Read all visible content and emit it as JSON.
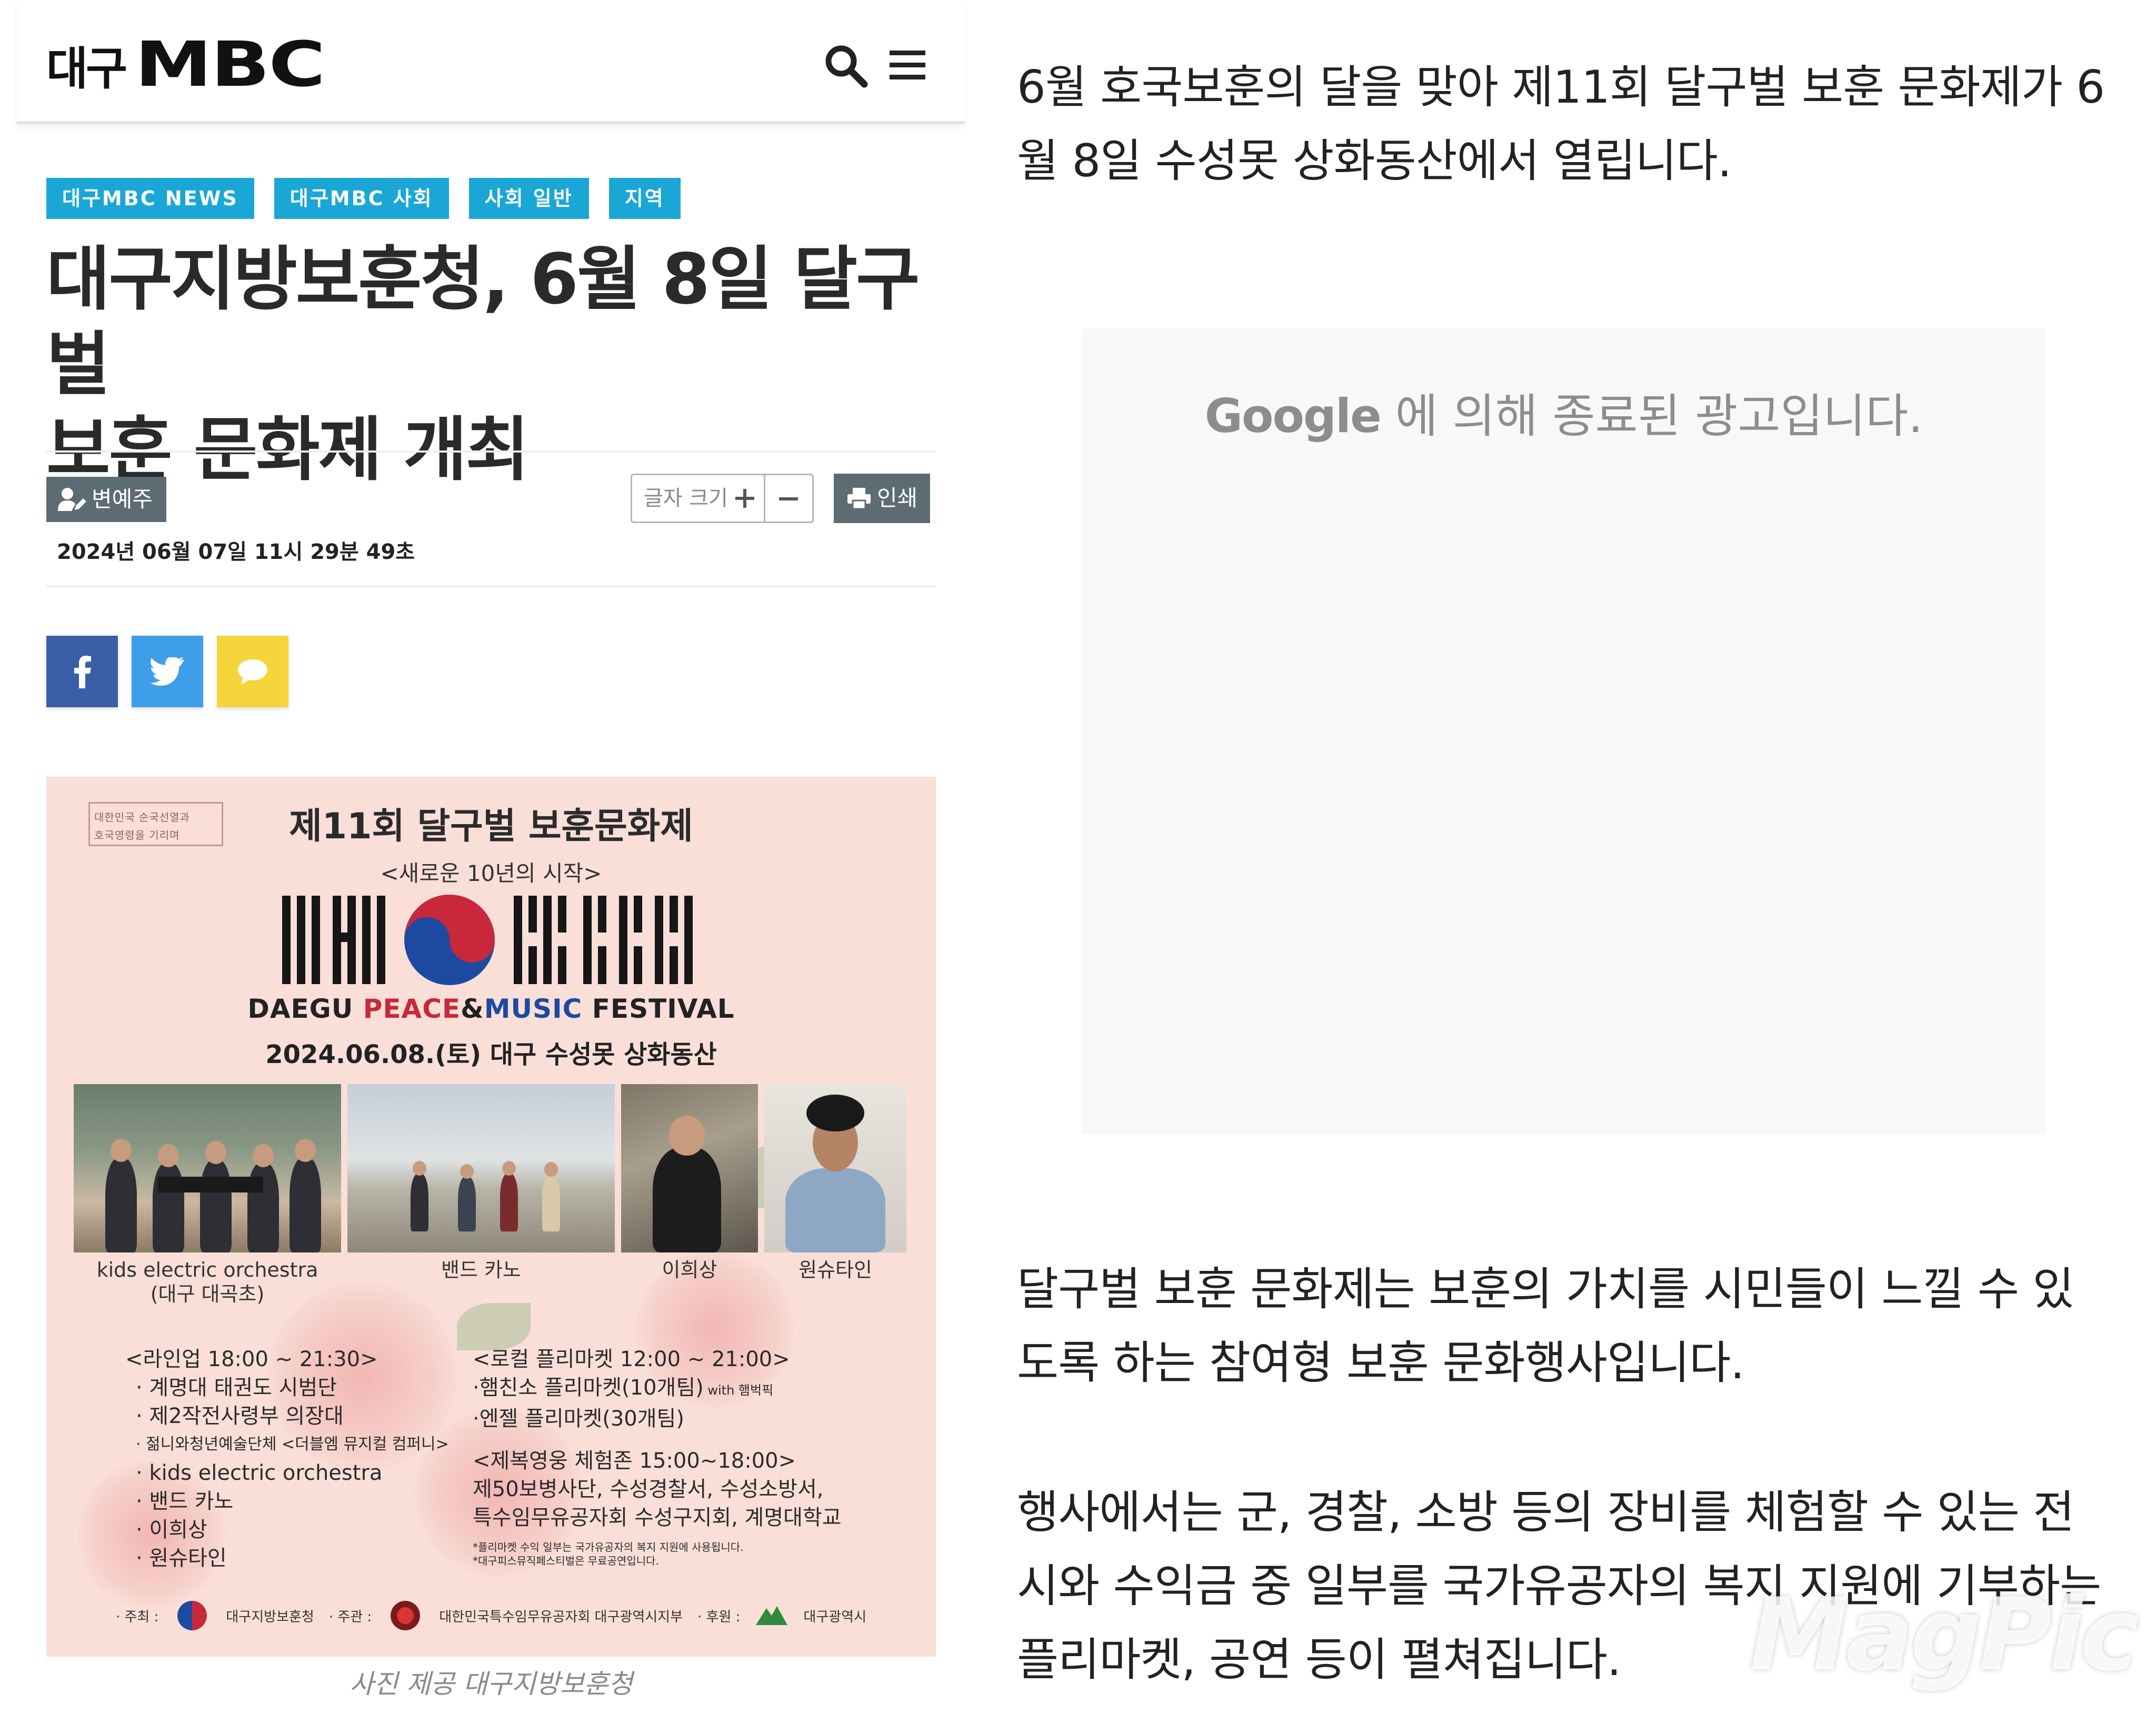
{
  "header": {
    "logo_region": "대구",
    "logo_brand": "MBC"
  },
  "tags": [
    "대구MBC NEWS",
    "대구MBC 사회",
    "사회 일반",
    "지역"
  ],
  "article": {
    "headline_line1": "대구지방보훈청, 6월 8일 달구벌",
    "headline_line2": "보훈 문화제 개최",
    "author": "변예주",
    "date": "2024년 06월 07일 11시 29분 49초",
    "font_size_label": "글자 크기",
    "print_label": "인쇄",
    "photo_credit": "사진 제공 대구지방보훈청"
  },
  "share": {
    "colors": {
      "facebook": "#3b5ea8",
      "twitter": "#3e9ee8",
      "kakao": "#f4d53c"
    }
  },
  "poster": {
    "seal_line1": "대한민국   순국선열과",
    "seal_line2": "호국영령을   기리며",
    "title": "제11회 달구벌 보훈문화제",
    "subtitle": "<새로운 10년의 시작>",
    "festival_part1": "DAEGU ",
    "festival_peace": "PEACE",
    "festival_amp": "&",
    "festival_music": "MUSIC",
    "festival_part2": " FESTIVAL",
    "date_place": "2024.06.08.(토) 대구 수성못 상화동산",
    "captions": [
      {
        "line1": "kids electric orchestra",
        "line2": "(대구 대곡초)"
      },
      {
        "line1": "밴드 카노",
        "line2": ""
      },
      {
        "line1": "이희상",
        "line2": ""
      },
      {
        "line1": "원슈타인",
        "line2": ""
      }
    ],
    "lineup_head": "<라인업 18:00 ~ 21:30>",
    "lineup_items": [
      "· 계명대 태권도 시범단",
      "· 제2작전사령부 의장대",
      "· 젊니와청년예술단체 <더블엠 뮤지컬 컴퍼니>",
      "· kids electric orchestra",
      "· 밴드 카노",
      "· 이희상",
      "· 원슈타인"
    ],
    "market_head": "<로컬 플리마켓 12:00 ~ 21:00>",
    "market_item1": "·햄친소 플리마켓(10개팀)",
    "market_item1_with": " with 햄벅픽",
    "market_item2": "·엔젤 플리마켓(30개팀)",
    "experience_head": "<제복영웅 체험존 15:00~18:00>",
    "experience_line1": "제50보병사단, 수성경찰서, 수성소방서,",
    "experience_line2": "특수임무유공자회 수성구지회, 계명대학교",
    "note1": "*플리마켓 수익 일부는 국가유공자의 복지 지원에 사용됩니다.",
    "note2": "*대구피스뮤직페스티벌은 무료공연입니다.",
    "footer_host_label": "· 주최 :",
    "footer_host": "대구지방보훈청",
    "footer_org_label": "· 주관 :",
    "footer_org": "대한민국특수임무유공자회 대구광역시지부",
    "footer_sponsor_label": "· 후원 :",
    "footer_sponsor": "대구광역시"
  },
  "body": {
    "para1": "6월 호국보훈의 달을 맞아 제11회 달구벌 보훈 문화제가 6월 8일 수성못 상화동산에서 열립니다.",
    "ad_brand": "Google",
    "ad_text": "에 의해 종료된 광고입니다.",
    "para2": "달구벌 보훈 문화제는 보훈의 가치를 시민들이 느낄 수 있도록 하는 참여형 보훈 문화행사입니다.",
    "para3": "행사에서는 군, 경찰, 소방 등의 장비를 체험할 수 있는 전시와 수익금 중 일부를 국가유공자의 복지 지원에 기부하는 플리마켓, 공연 등이 펼쳐집니다."
  },
  "watermark": "MagPic",
  "colors": {
    "tag_bg": "#1ba7d6",
    "button_bg": "#5d6c73",
    "poster_bg": "#f9dfd8"
  }
}
